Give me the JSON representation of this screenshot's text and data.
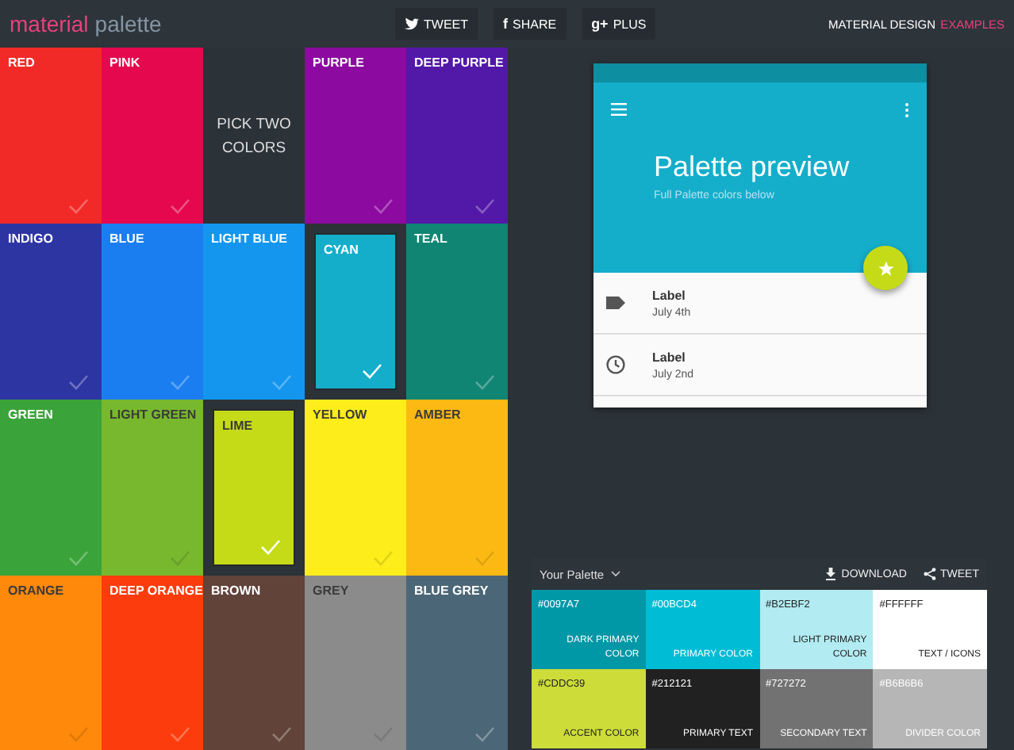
{
  "header": {
    "logo": {
      "first": "material",
      "second": "palette"
    },
    "share_buttons": [
      {
        "kind": "bird",
        "label": "TWEET"
      },
      {
        "kind": "glyph",
        "glyph": "f",
        "label": "SHARE"
      },
      {
        "kind": "glyph",
        "glyph": "g+",
        "label": "PLUS"
      }
    ],
    "link": {
      "first": "MATERIAL DESIGN",
      "second": "EXAMPLES"
    }
  },
  "tiles": [
    {
      "kind": "color",
      "name": "RED",
      "color": "#f22a27",
      "selected": false
    },
    {
      "kind": "color",
      "name": "PINK",
      "color": "#e5084f",
      "selected": false
    },
    {
      "kind": "prompt",
      "text": "PICK TWO COLORS"
    },
    {
      "kind": "color",
      "name": "PURPLE",
      "color": "#8c0aa0",
      "selected": false
    },
    {
      "kind": "color",
      "name": "DEEP PURPLE",
      "color": "#5218a8",
      "selected": false
    },
    {
      "kind": "color",
      "name": "INDIGO",
      "color": "#2d35a3",
      "selected": false
    },
    {
      "kind": "color",
      "name": "BLUE",
      "color": "#1a7ef0",
      "selected": false
    },
    {
      "kind": "color",
      "name": "LIGHT BLUE",
      "color": "#1496ef",
      "selected": false
    },
    {
      "kind": "color",
      "name": "CYAN",
      "color": "#14aecb",
      "selected": true
    },
    {
      "kind": "color",
      "name": "TEAL",
      "color": "#108573",
      "selected": false
    },
    {
      "kind": "color",
      "name": "GREEN",
      "color": "#3aa33a",
      "selected": false
    },
    {
      "kind": "color",
      "name": "LIGHT GREEN",
      "color": "#78b82e",
      "selected": false
    },
    {
      "kind": "color",
      "name": "LIME",
      "color": "#c6db18",
      "selected": true
    },
    {
      "kind": "color",
      "name": "YELLOW",
      "color": "#fded1a",
      "selected": false
    },
    {
      "kind": "color",
      "name": "AMBER",
      "color": "#fdb913",
      "selected": false
    },
    {
      "kind": "color",
      "name": "ORANGE",
      "color": "#fe890b",
      "selected": false
    },
    {
      "kind": "color",
      "name": "DEEP ORANGE",
      "color": "#fc3c0c",
      "selected": false
    },
    {
      "kind": "color",
      "name": "BROWN",
      "color": "#61433a",
      "selected": false
    },
    {
      "kind": "color",
      "name": "GREY",
      "color": "#8b8b8b",
      "selected": false
    },
    {
      "kind": "color",
      "name": "BLUE GREY",
      "color": "#4b6677",
      "selected": false
    }
  ],
  "preview": {
    "title": "Palette preview",
    "subtitle": "Full Palette colors below",
    "list": [
      {
        "kind": "tag",
        "primary": "Label",
        "secondary": "July 4th"
      },
      {
        "kind": "clock",
        "primary": "Label",
        "secondary": "July 2nd"
      }
    ]
  },
  "palette": {
    "title": "Your Palette",
    "actions": [
      {
        "kind": "download",
        "label": "DOWNLOAD"
      },
      {
        "kind": "share",
        "label": "TWEET"
      }
    ],
    "swatches": [
      {
        "hex": "#0097A7",
        "label": "DARK PRIMARY COLOR",
        "color": "#0097a7"
      },
      {
        "hex": "#00BCD4",
        "label": "PRIMARY COLOR",
        "color": "#00bcd4"
      },
      {
        "hex": "#B2EBF2",
        "label": "LIGHT PRIMARY COLOR",
        "color": "#b2ebf2"
      },
      {
        "hex": "#FFFFFF",
        "label": "TEXT / ICONS",
        "color": "#ffffff"
      },
      {
        "hex": "#CDDC39",
        "label": "ACCENT COLOR",
        "color": "#cddc39"
      },
      {
        "hex": "#212121",
        "label": "PRIMARY TEXT",
        "color": "#212121"
      },
      {
        "hex": "#727272",
        "label": "SECONDARY TEXT",
        "color": "#727272"
      },
      {
        "hex": "#B6B6B6",
        "label": "DIVIDER COLOR",
        "color": "#b6b6b6"
      }
    ]
  }
}
